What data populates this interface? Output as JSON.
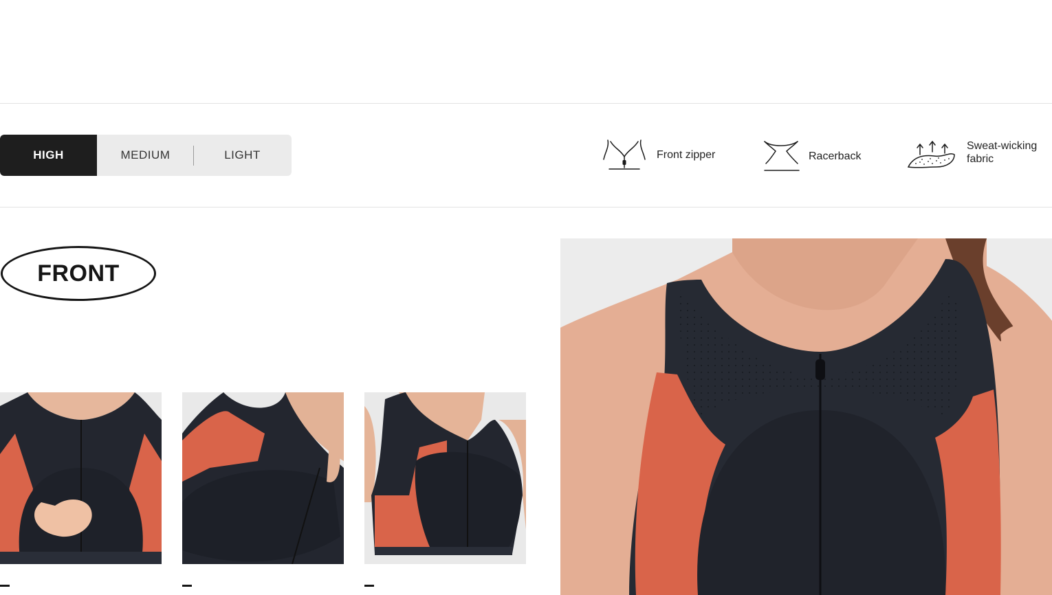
{
  "support_levels": {
    "items": [
      "HIGH",
      "MEDIUM",
      "LIGHT"
    ],
    "selected": "HIGH"
  },
  "features": [
    {
      "icon": "front-zipper-icon",
      "label": "Front zipper"
    },
    {
      "icon": "racerback-icon",
      "label": "Racerback"
    },
    {
      "icon": "sweat-wicking-icon",
      "label_line1": "Sweat-wicking",
      "label_line2": "fabric"
    }
  ],
  "section": {
    "title": "FRONT"
  },
  "gallery": {
    "thumbnails": [
      {
        "view": "front"
      },
      {
        "view": "side-angle"
      },
      {
        "view": "three-quarter"
      }
    ]
  },
  "colors": {
    "garment": "#23262f",
    "accent": "#d9644a",
    "skin": "#e8b9a0",
    "active_tab": "#1e1e1e",
    "tab_bg": "#ebebeb"
  }
}
